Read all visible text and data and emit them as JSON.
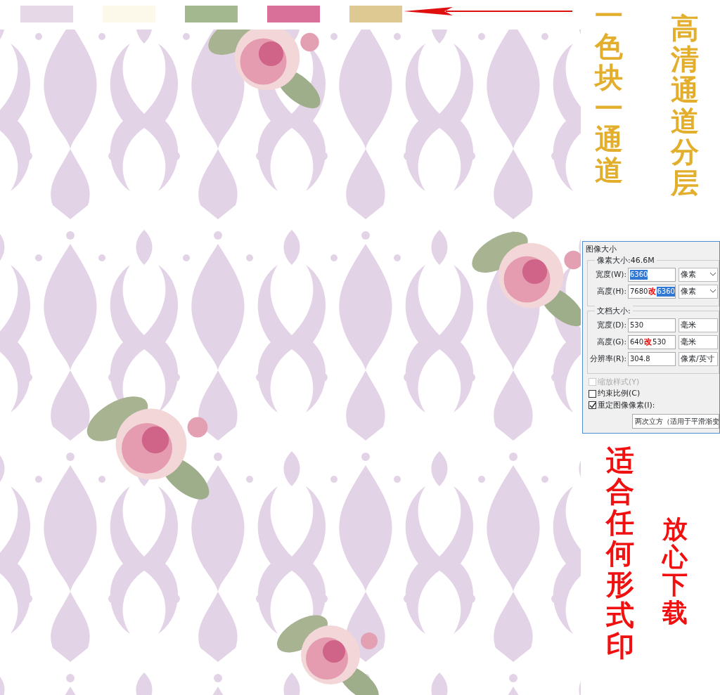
{
  "swatches": [
    {
      "color": "#e6d8e6"
    },
    {
      "color": "#fdf9ea"
    },
    {
      "color": "#a3b88e"
    },
    {
      "color": "#d9709a"
    },
    {
      "color": "#dfc992"
    }
  ],
  "slogans_top": [
    {
      "text": "一色块一通道",
      "color": "#e2ae2c"
    },
    {
      "text": "高清通道分层",
      "color": "#e2ae2c"
    }
  ],
  "dialog": {
    "title": "图像大小",
    "groups": [
      {
        "title": "像素大小:46.6M",
        "rows": [
          {
            "label": "宽度(W):",
            "parts": [
              {
                "kind": "selected",
                "text": "6360"
              }
            ],
            "unit": "像素",
            "caret": true
          },
          {
            "label": "高度(H):",
            "parts": [
              {
                "kind": "plain",
                "text": "7680"
              },
              {
                "kind": "mark",
                "text": "改"
              },
              {
                "kind": "selected",
                "text": "6360"
              }
            ],
            "unit": "像素",
            "caret": true
          }
        ]
      },
      {
        "title": "文档大小:",
        "rows": [
          {
            "label": "宽度(D):",
            "parts": [
              {
                "kind": "plain",
                "text": "530"
              }
            ],
            "unit": "毫米",
            "caret": false
          },
          {
            "label": "高度(G):",
            "parts": [
              {
                "kind": "plain",
                "text": "640"
              },
              {
                "kind": "mark",
                "text": "改"
              },
              {
                "kind": "plain",
                "text": "530"
              }
            ],
            "unit": "毫米",
            "caret": false
          },
          {
            "label": "分辨率(R):",
            "parts": [
              {
                "kind": "plain",
                "text": "304.8"
              }
            ],
            "unit": "像素/英寸",
            "caret": false
          }
        ]
      }
    ],
    "checkboxes": [
      {
        "label": "缩放样式(Y)",
        "checked": false,
        "disabled": true
      },
      {
        "label": "约束比例(C)",
        "checked": false,
        "disabled": false
      },
      {
        "label": "重定图像像素(I):",
        "checked": true,
        "disabled": false
      }
    ],
    "resample": "两次立方（适用于平滑渐变"
  },
  "slogans_bottom": [
    {
      "text": "适合任何形式印",
      "color": "#f01010"
    },
    {
      "text": "放心下载",
      "color": "#f01010"
    }
  ]
}
